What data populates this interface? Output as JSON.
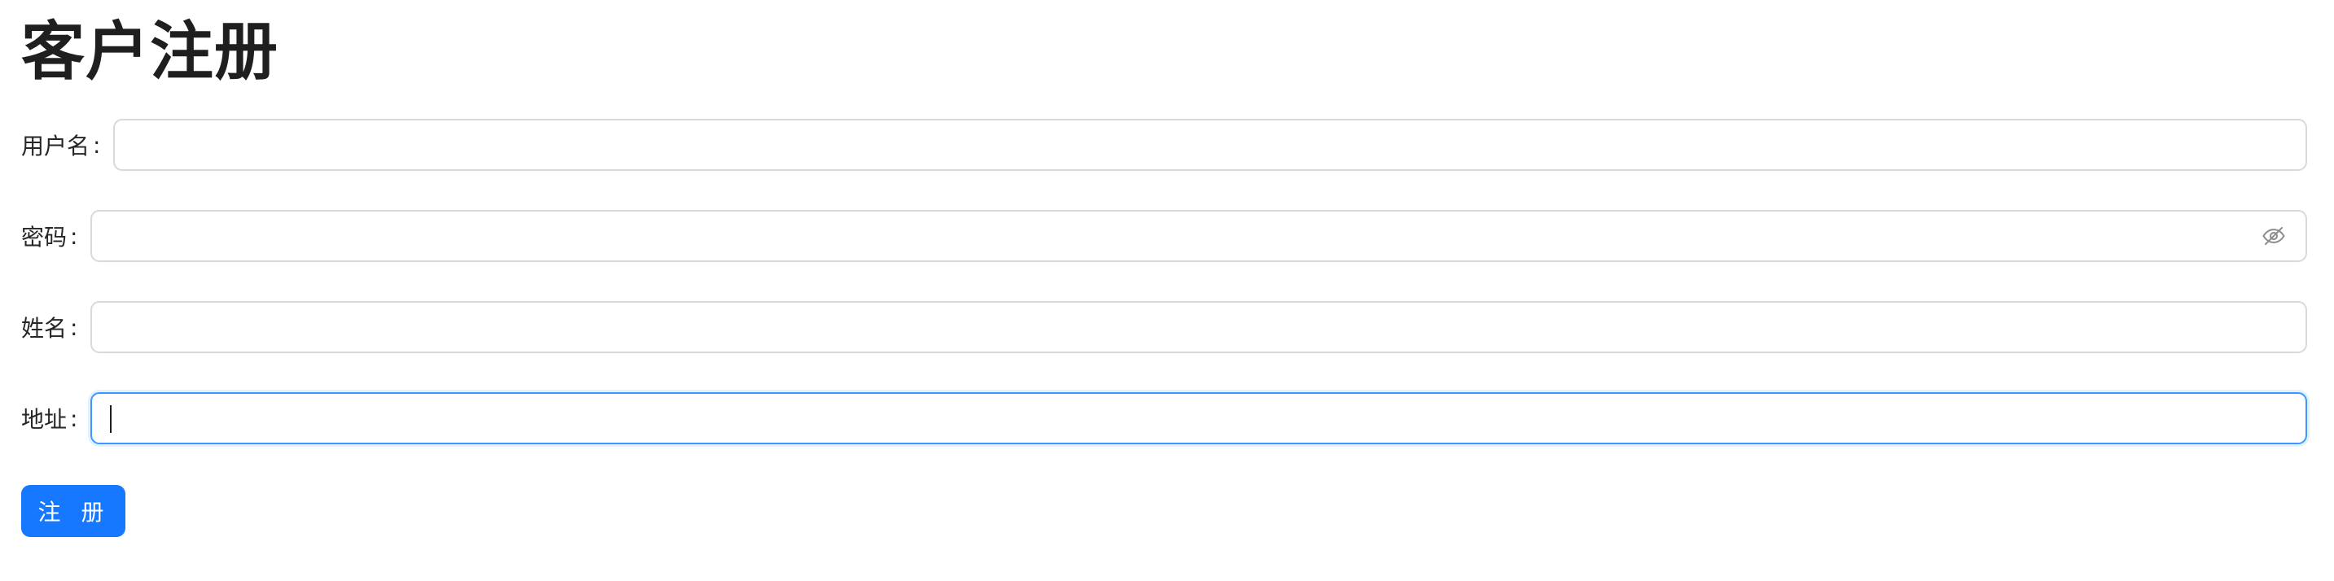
{
  "page": {
    "title": "客户注册"
  },
  "form": {
    "fields": [
      {
        "label": "用户名",
        "colon": ":",
        "value": "",
        "placeholder": ""
      },
      {
        "label": "密码",
        "colon": ":",
        "value": "",
        "placeholder": "",
        "icon": "eye-invisible-icon"
      },
      {
        "label": "姓名",
        "colon": ":",
        "value": "",
        "placeholder": ""
      },
      {
        "label": "地址",
        "colon": ":",
        "value": "",
        "placeholder": "",
        "focused": true
      }
    ],
    "submit_label": "注 册"
  },
  "colors": {
    "primary": "#1677ff",
    "border": "#d9d9d9",
    "focus_border": "#4096ff",
    "text": "#1f1f1f"
  }
}
